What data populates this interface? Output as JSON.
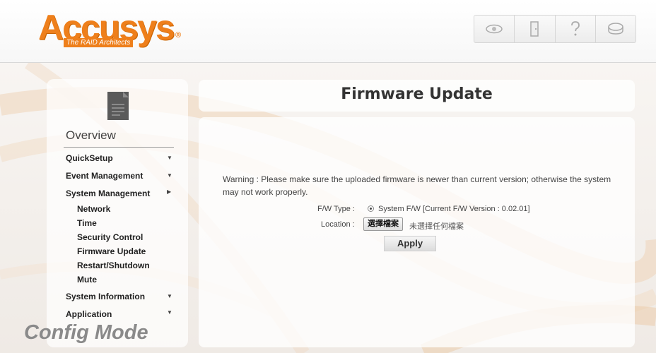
{
  "brand": {
    "name": "Accusys",
    "registered": "®",
    "tagline": "The RAID Architects",
    "color": "#ee7f1b"
  },
  "toolbar": {
    "buttons": [
      {
        "icon": "eye-icon"
      },
      {
        "icon": "door-icon"
      },
      {
        "icon": "help-icon"
      },
      {
        "icon": "disk-icon"
      }
    ]
  },
  "sidebar": {
    "overview": "Overview",
    "menu": [
      {
        "label": "QuickSetup"
      },
      {
        "label": "Event Management"
      },
      {
        "label": "System Management"
      },
      {
        "label": "System Information"
      },
      {
        "label": "Application"
      }
    ],
    "submenu": [
      {
        "label": "Network"
      },
      {
        "label": "Time"
      },
      {
        "label": "Security Control"
      },
      {
        "label": "Firmware Update"
      },
      {
        "label": "Restart/Shutdown"
      },
      {
        "label": "Mute"
      }
    ],
    "mode": "Config Mode"
  },
  "main": {
    "title": "Firmware Update",
    "warning": "Warning : Please make sure the uploaded firmware is newer than current version; otherwise the system may not work properly.",
    "fw_type_label": "F/W Type :",
    "fw_type_value": "System F/W [Current F/W Version : 0.02.01]",
    "location_label": "Location :",
    "file_button": "選擇檔案",
    "file_status": "未選擇任何檔案",
    "apply": "Apply"
  }
}
